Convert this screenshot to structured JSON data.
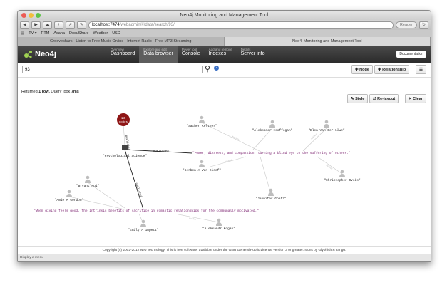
{
  "window": {
    "title": "Neo4j Monitoring and Management Tool"
  },
  "browser": {
    "url_host": "localhost:7474",
    "url_path": "/webadmin/#/data/search/93/",
    "reader_label": "Reader",
    "bookmarks": [
      "TV ▾",
      "RTM",
      "Asana",
      "DocuShare",
      "Weather",
      "USD"
    ],
    "tabs": [
      {
        "label": "Grooveshark - Listen to Free Music Online - Internet Radio - Free MP3 Streaming",
        "active": false
      },
      {
        "label": "Neo4j Monitoring and Management Tool",
        "active": true
      }
    ]
  },
  "app": {
    "logo_text": "Neo4j",
    "nav": [
      {
        "small": "Overview",
        "big": "Dashboard",
        "active": false
      },
      {
        "small": "Explore and edit",
        "big": "Data browser",
        "active": true
      },
      {
        "small": "Power tool",
        "big": "Console",
        "active": false
      },
      {
        "small": "Add and remove",
        "big": "Indexes",
        "active": false
      },
      {
        "small": "Details",
        "big": "Server info",
        "active": false
      }
    ],
    "documentation_label": "Documentation"
  },
  "search": {
    "value": "93"
  },
  "actions": {
    "node_label": "Node",
    "relationship_label": "Relationship"
  },
  "status": {
    "prefix": "Returned",
    "count": "1 row.",
    "query_prefix": "Query took",
    "query_time": "7ms"
  },
  "graph_tools": {
    "style_label": "Style",
    "relayout_label": "Re-layout",
    "clear_label": "Clear"
  },
  "graph": {
    "cluster": {
      "count": "23",
      "label": "nodes"
    },
    "nodes": [
      {
        "label": "\"Psychological Science\""
      },
      {
        "label": "\"Sacher Keltner\""
      },
      {
        "label": "\"Aleksandr Isoffogan\""
      },
      {
        "label": "\"Elen Van Der Löwe\""
      },
      {
        "label": "\"Gerben A Van Kleef\""
      },
      {
        "label": "\"Christopher Oveis\""
      },
      {
        "label": "\"Jennifer Goetz\""
      },
      {
        "label": "\"Bryant Hui\""
      },
      {
        "label": "\"Amie M Gordon\""
      },
      {
        "label": "\"Emily A Impett\""
      },
      {
        "label": "\"Aleksandr Kogan\""
      }
    ],
    "papers": [
      {
        "label": "\"Power, distress, and compassion: turning a blind eye to the suffering of others.\""
      },
      {
        "label": "\"When giving feels good. The intrinsic benefits of sacrifice in romantic relationships for the communally motivated.\""
      }
    ],
    "edge_labels": {
      "published": "published",
      "small": "author"
    }
  },
  "footer": {
    "copyright": "Copyright (c) 2002-2012",
    "company": "Neo Technology",
    "text1": ". This is free software, available under the",
    "license": "GNU General Public License",
    "text2": "version 3 or greater. Icons by",
    "icons1": "Glyphish",
    "and": "&",
    "icons2": "Tango",
    "end": "."
  },
  "statusbar": {
    "text": "Display a menu"
  },
  "colors": {
    "accent": "#8e1515",
    "paper_text": "#7a1f6e",
    "header_bg": "#333333"
  }
}
